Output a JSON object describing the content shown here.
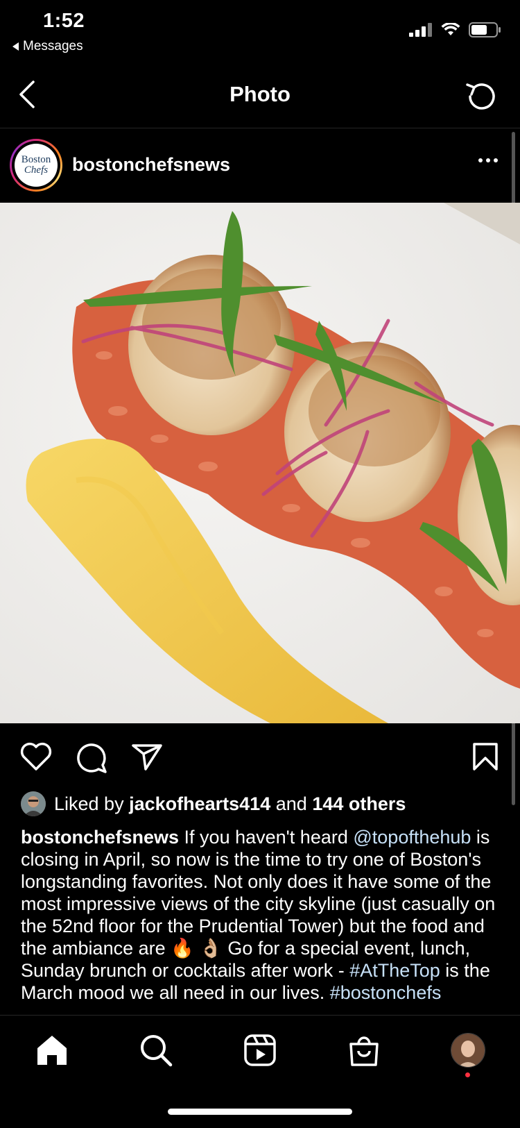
{
  "status": {
    "time": "1:52",
    "back_app": "Messages"
  },
  "nav": {
    "title": "Photo"
  },
  "post": {
    "username": "bostonchefsnews",
    "avatar_text_1": "Boston",
    "avatar_text_2": "Chefs",
    "liked_prefix": "Liked by",
    "liked_user": "jackofhearts414",
    "liked_and": "and",
    "liked_others": "144 others",
    "caption_user": "bostonchefsnews",
    "caption_1": " If you haven't heard ",
    "caption_mention": "@topofthehub",
    "caption_2": " is closing in April, so now is the time to try one of Boston's longstanding favorites. Not only does it have some of the most impressive views of the city skyline (just casually on the 52nd floor for the Prudential Tower) but the food and the ambiance are ",
    "caption_emoji": "🔥 👌🏼",
    "caption_3": " Go for a special event, lunch, Sunday brunch or cocktails after work - ",
    "caption_hashtag": "#AtTheTop",
    "caption_4": " is the March mood we all need in our lives. ",
    "caption_hashtag2": "#bostonchefs"
  },
  "tabs": [
    {
      "name": "home",
      "icon": "home-icon"
    },
    {
      "name": "search",
      "icon": "search-icon"
    },
    {
      "name": "reels",
      "icon": "reels-icon"
    },
    {
      "name": "shop",
      "icon": "shop-icon"
    },
    {
      "name": "profile",
      "icon": "profile-avatar"
    }
  ],
  "colors": {
    "background": "#000000",
    "link": "#c7e1f8",
    "notification_dot": "#ff3040"
  }
}
